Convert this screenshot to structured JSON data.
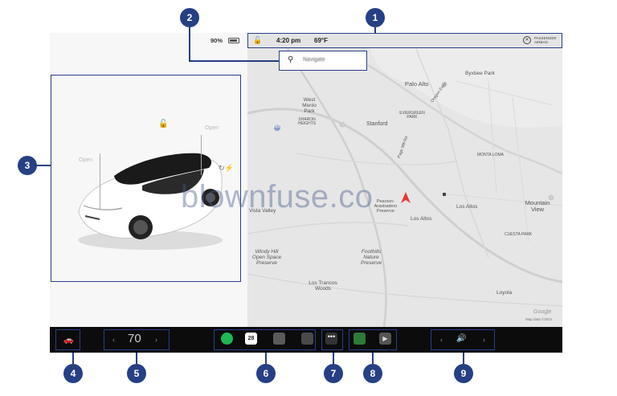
{
  "status_bar": {
    "battery_percent": "90%",
    "time": "4:20 pm",
    "temperature": "69°F",
    "airbag_text": "PASSENGER AIRBAG"
  },
  "search": {
    "icon": "search-icon",
    "value": "Navigate"
  },
  "car_panel": {
    "left_label": "Open",
    "right_label": "Open",
    "lock_icon": "unlock-icon",
    "charge_icon": "charge-port-icon"
  },
  "map": {
    "labels": {
      "palo_alto": "Palo Alto",
      "byxbee": "Byxbee Park",
      "west_menlo": "West Menlo Park",
      "sharon": "SHARON HEIGHTS",
      "stanford": "Stanford",
      "evergreen": "EVERGREEN PARK",
      "oregon": "Oregon Expy",
      "page_mill": "Page Mill Rd",
      "monta": "MONTA LOMA",
      "loyola_corners": "Los Altos",
      "mountain_view": "Mountain View",
      "cuesta": "CUESTA PARK",
      "los_altos": "Los Altos",
      "los_altos_hills": "Los Altos Hills",
      "pearson": "Pearson-Arastradero Preserve",
      "windy_hill": "Windy Hill Open Space Preserve",
      "foothills": "Foothills Nature Preserve",
      "los_trancos": "Los Trancos Woods",
      "loyola": "Loyola",
      "valley": "Vista Valley",
      "google": "Google",
      "map_data": "Map data ©2021",
      "highway_280": "280"
    }
  },
  "bottom_bar": {
    "speed": "70",
    "calendar_day": "28",
    "more_label": "•••",
    "theater_glyph": "▶"
  },
  "callouts": [
    "1",
    "2",
    "3",
    "4",
    "5",
    "6",
    "7",
    "8",
    "9"
  ],
  "watermark": "blownfuse.co",
  "colors": {
    "accent": "#263f85",
    "bottom_bar": "#0c0c0c",
    "map_bg": "#e7e7e7",
    "nav_arrow": "#e53935",
    "spotify": "#1db954"
  }
}
